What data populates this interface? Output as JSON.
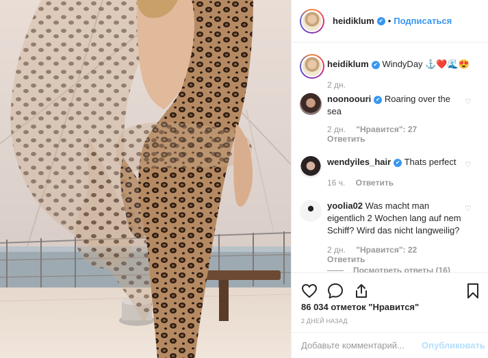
{
  "header": {
    "username": "heidiklum",
    "dot": "•",
    "follow_label": "Подписаться"
  },
  "caption": {
    "username": "heidiklum",
    "text": "WindyDay ⚓❤️🌊😍",
    "time": "2 дн."
  },
  "comments": [
    {
      "username": "noonoouri",
      "text": "Roaring over the sea",
      "time": "2 дн.",
      "likes": "\"Нравится\": 27",
      "reply": "Ответить",
      "verified": true
    },
    {
      "username": "wendyiles_hair",
      "text": "Thats perfect",
      "time": "16 ч.",
      "reply": "Ответить",
      "verified": true
    },
    {
      "username": "yoolia02",
      "text": "Was macht man eigentlich 2 Wochen lang auf nem Schiff? Wird das nicht langweilig?",
      "time": "2 дн.",
      "likes": "\"Нравится\": 22",
      "reply": "Ответить",
      "verified": false,
      "view_replies": "Посмотреть ответы (16)"
    }
  ],
  "actions": {
    "likes_count": "86 034 отметок \"Нравится\"",
    "date": "2 ДНЕЙ НАЗАД"
  },
  "add_comment": {
    "placeholder": "Добавьте комментарий...",
    "publish_label": "Опубликовать"
  },
  "icons": [
    "heart-icon",
    "comment-icon",
    "share-icon",
    "bookmark-icon",
    "verified-icon"
  ]
}
